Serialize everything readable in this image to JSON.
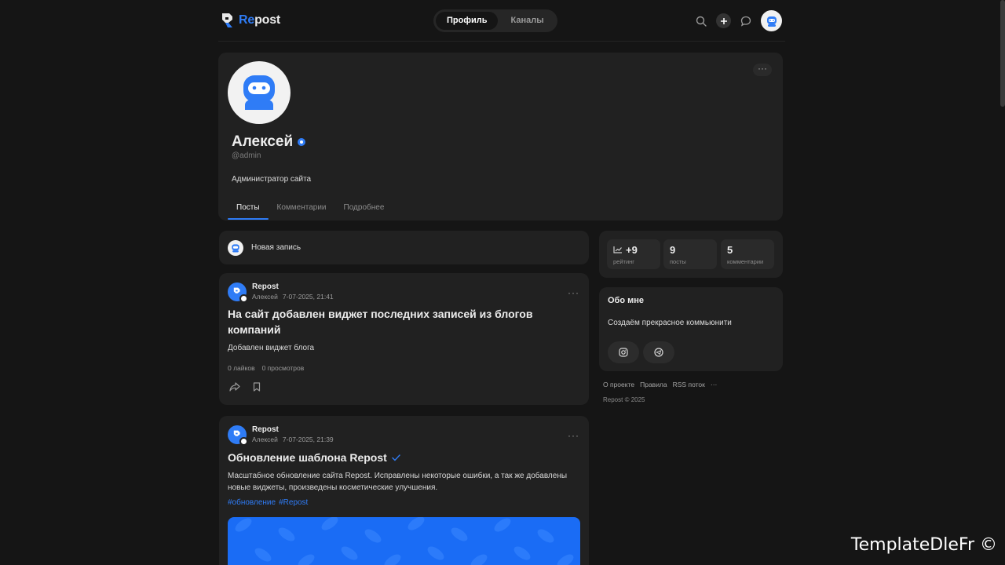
{
  "header": {
    "logo_accent": "Re",
    "logo_rest": "post",
    "tabs": [
      {
        "label": "Профиль"
      },
      {
        "label": "Каналы"
      }
    ]
  },
  "profile": {
    "name": "Алексей",
    "handle": "@admin",
    "bio": "Администратор сайта",
    "more": "···",
    "tabs": [
      {
        "label": "Посты"
      },
      {
        "label": "Комментарии"
      },
      {
        "label": "Подробнее"
      }
    ]
  },
  "new_post": {
    "label": "Новая запись"
  },
  "posts": [
    {
      "source": "Repost",
      "author": "Алексей",
      "date": "7-07-2025, 21:41",
      "title": "На сайт добавлен виджет последних записей из блогов компаний",
      "text": "Добавлен виджет блога",
      "likes": "0 лайков",
      "views": "0 просмотров"
    },
    {
      "source": "Repost",
      "author": "Алексей",
      "date": "7-07-2025, 21:39",
      "title": "Обновление шаблона Repost",
      "text": "Масштабное обновление сайта Repost. Исправлены некоторые ошибки, а так же добавлены новые виджеты, произведены косметические улучшения.",
      "tags": [
        "#обновление",
        "#Repost"
      ]
    }
  ],
  "stats": [
    {
      "value": "+9",
      "label": "рейтинг"
    },
    {
      "value": "9",
      "label": "посты"
    },
    {
      "value": "5",
      "label": "комментарии"
    }
  ],
  "about": {
    "title": "Обо мне",
    "text": "Создаём прекрасное коммьюнити"
  },
  "footer": {
    "links": [
      "О проекте",
      "Правила",
      "RSS поток",
      "···"
    ],
    "copyright": "Repost © 2025"
  },
  "watermark": "TemplateDleFr ©",
  "colors": {
    "accent": "#2f7cf6",
    "background": "#151515",
    "card": "#212121"
  }
}
